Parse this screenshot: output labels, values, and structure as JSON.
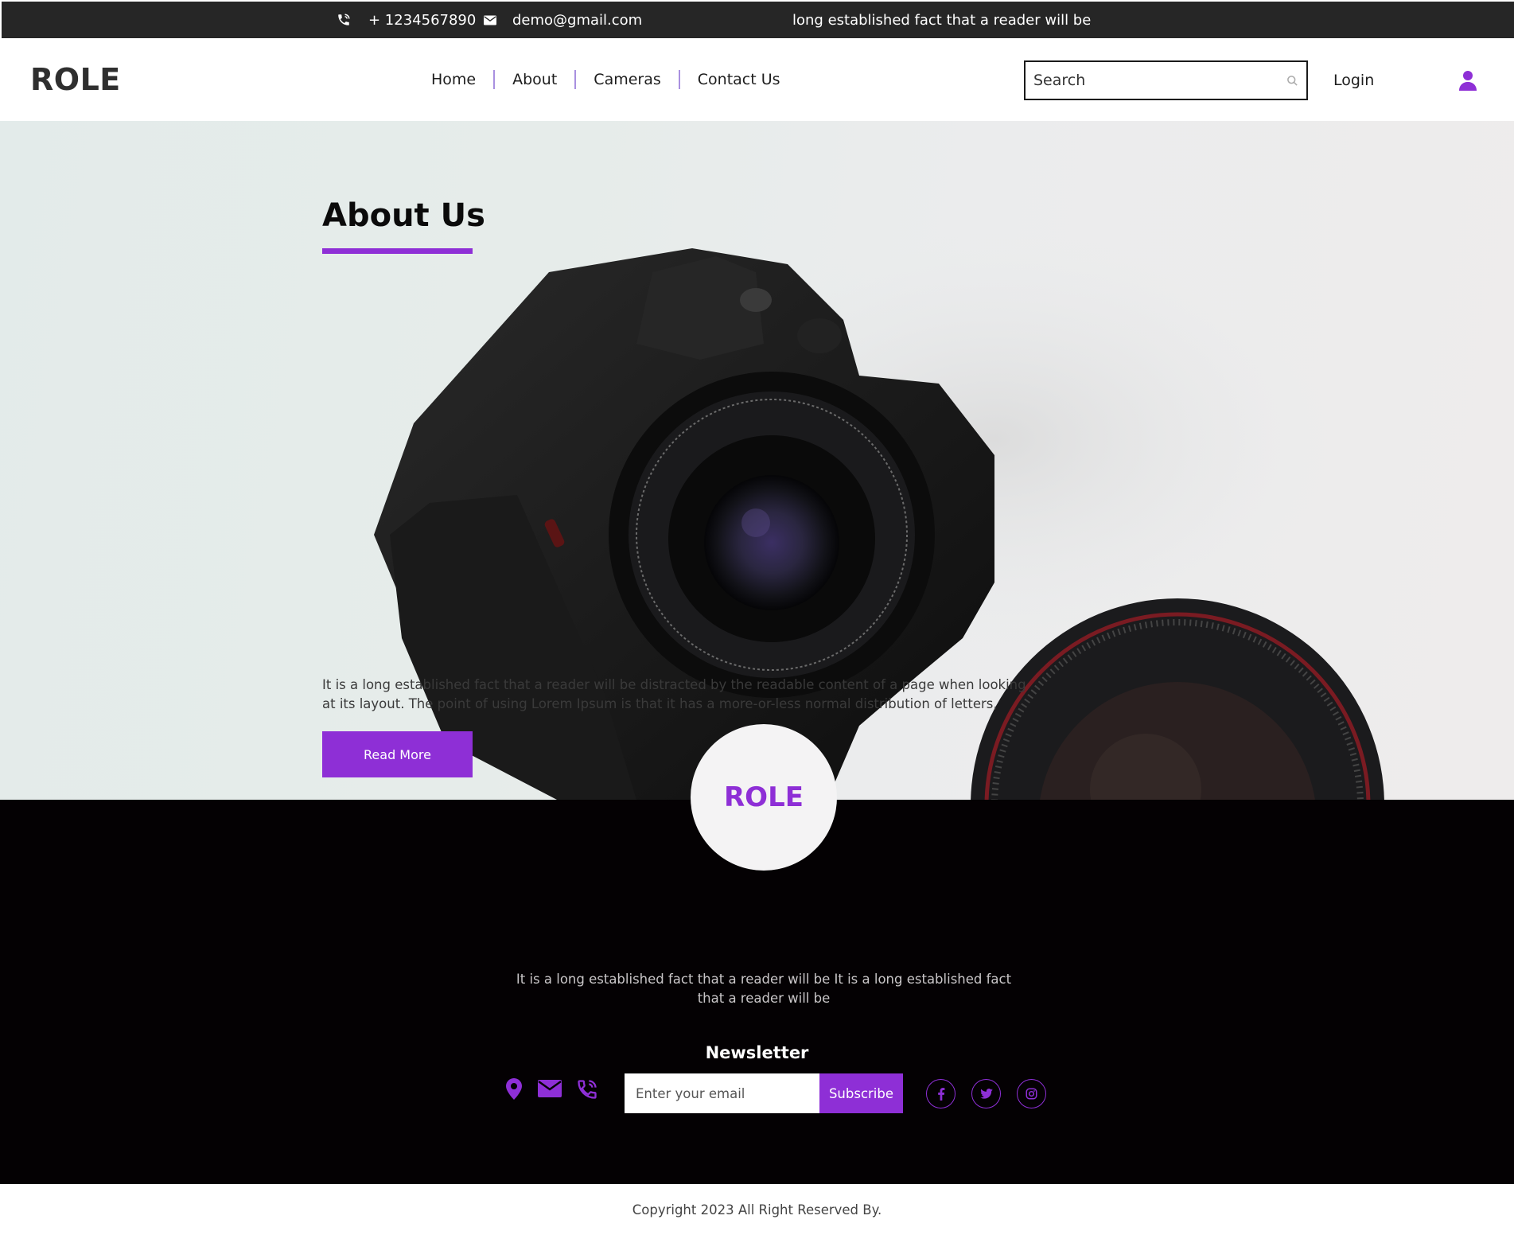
{
  "topbar": {
    "phone": "+ 1234567890",
    "email": "demo@gmail.com",
    "tagline": "long established fact that a reader will be",
    "phone_icon": "phone-icon",
    "mail_icon": "mail-icon"
  },
  "header": {
    "logo": "ROLE",
    "nav": [
      "Home",
      "About",
      "Cameras",
      "Contact Us"
    ],
    "search_placeholder": "Search",
    "login_label": "Login",
    "user_icon": "user-icon"
  },
  "hero": {
    "title": "About Us",
    "text": "It is a long established fact that a reader will be distracted by the readable content of a page when looking at its layout. The point of using Lorem Ipsum is that it has a more-or-less normal distribution of letters,",
    "button_label": "Read More"
  },
  "footer": {
    "logo": "ROLE",
    "text": "It is a long established fact that a reader will be It is a long established fact that a reader will be",
    "newsletter_title": "Newsletter",
    "email_placeholder": "Enter your email",
    "subscribe_label": "Subscribe",
    "contact_icons": [
      "location-icon",
      "mail-icon",
      "phone-icon"
    ],
    "social_icons": [
      "facebook-icon",
      "twitter-icon",
      "instagram-icon"
    ]
  },
  "copyright": "Copyright 2023 All Right Reserved By.",
  "colors": {
    "accent": "#8e2fd6",
    "topbar_bg": "#262626",
    "footer_bg": "#040103",
    "hero_bg": "#e6ecea"
  }
}
